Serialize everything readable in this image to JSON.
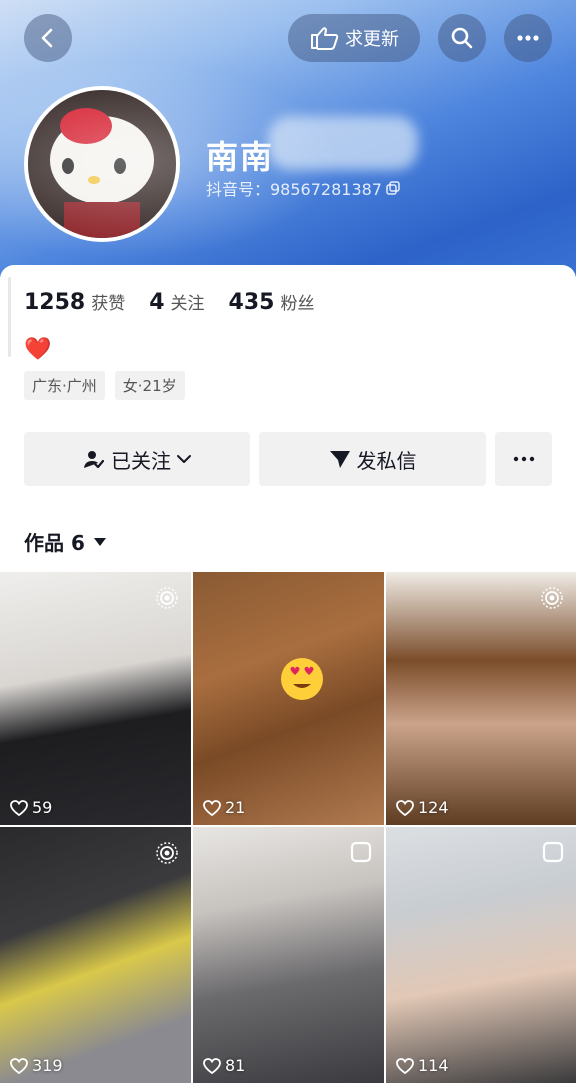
{
  "header": {
    "update_label": "求更新",
    "nickname": "南南",
    "douyin_id": "抖音号：98567281387"
  },
  "stats": [
    {
      "num": "1258",
      "label": "获赞"
    },
    {
      "num": "4",
      "label": "关注"
    },
    {
      "num": "435",
      "label": "粉丝"
    }
  ],
  "bio": "❤️",
  "tags": [
    "广东·广州",
    "女·21岁"
  ],
  "actions": {
    "follow": "已关注",
    "message": "发私信"
  },
  "works_tab": "作品 6",
  "works": [
    {
      "likes": "59",
      "badge": "live-photo-icon"
    },
    {
      "likes": "21",
      "badge": ""
    },
    {
      "likes": "124",
      "badge": "live-photo-icon"
    },
    {
      "likes": "319",
      "badge": "live-photo-icon"
    },
    {
      "likes": "81",
      "badge": "gallery-icon"
    },
    {
      "likes": "114",
      "badge": "gallery-icon"
    }
  ]
}
